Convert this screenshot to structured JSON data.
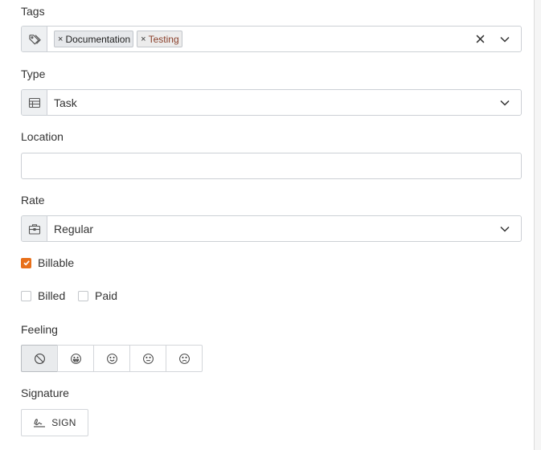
{
  "tags": {
    "label": "Tags",
    "items": [
      {
        "remove": "×",
        "text": "Documentation"
      },
      {
        "remove": "×",
        "text": "Testing"
      }
    ]
  },
  "type": {
    "label": "Type",
    "value": "Task"
  },
  "location": {
    "label": "Location",
    "value": ""
  },
  "rate": {
    "label": "Rate",
    "value": "Regular"
  },
  "billable": {
    "label": "Billable",
    "checked": true
  },
  "billed": {
    "label": "Billed",
    "checked": false
  },
  "paid": {
    "label": "Paid",
    "checked": false
  },
  "feeling": {
    "label": "Feeling",
    "options": [
      "none-icon",
      "grin-icon",
      "smile-icon",
      "neutral-icon",
      "sad-icon"
    ],
    "selected_index": 0
  },
  "signature": {
    "label": "Signature",
    "button": "SIGN"
  },
  "colors": {
    "accent": "#e8701a",
    "border": "#ccd0d5",
    "addon_bg": "#eef0f2"
  }
}
